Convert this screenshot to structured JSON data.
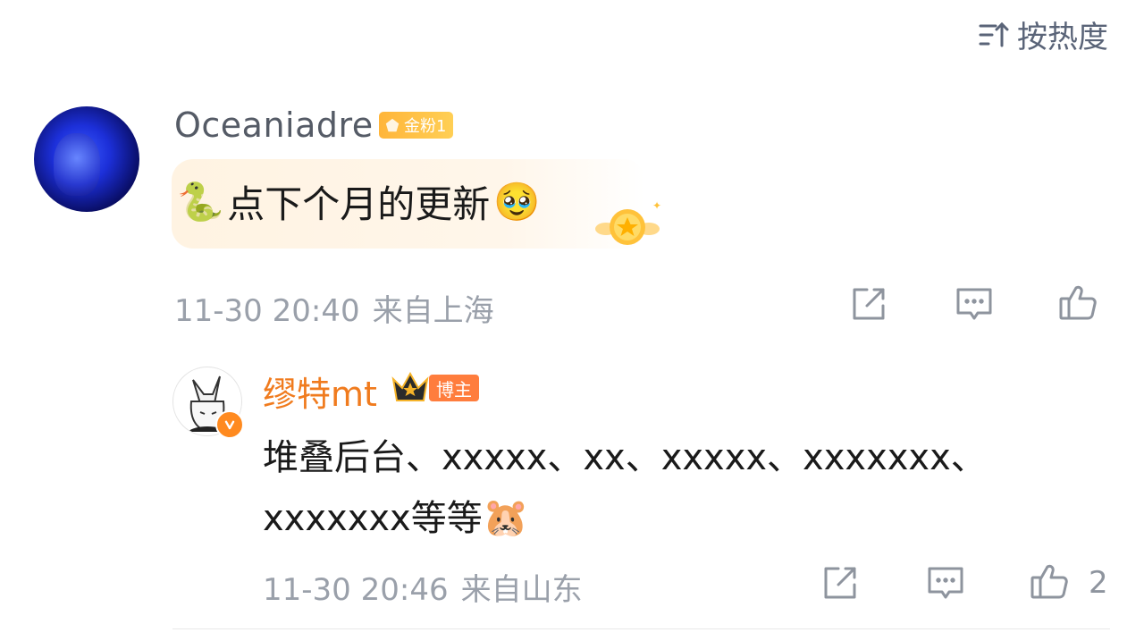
{
  "sort": {
    "label": "按热度",
    "icon": "sort-icon"
  },
  "comment": {
    "username": "Oceaniadre",
    "badge": "金粉1",
    "text": "点下个月的更新",
    "lead_emoji": "🐍",
    "trail_emoji": "🥹",
    "time": "11-30 20:40",
    "location": "来自上海"
  },
  "reply": {
    "username": "缪特mt",
    "role_badge": "博主",
    "text": "堆叠后台、xxxxx、xx、xxxxx、xxxxxxx、xxxxxxx等等",
    "trail_emoji": "🐹",
    "time": "11-30 20:46",
    "location": "来自山东",
    "like_count": "2"
  },
  "colors": {
    "accent": "#f07b1e",
    "meta": "#9aa0aa",
    "fan_badge": "#ffb53a"
  }
}
